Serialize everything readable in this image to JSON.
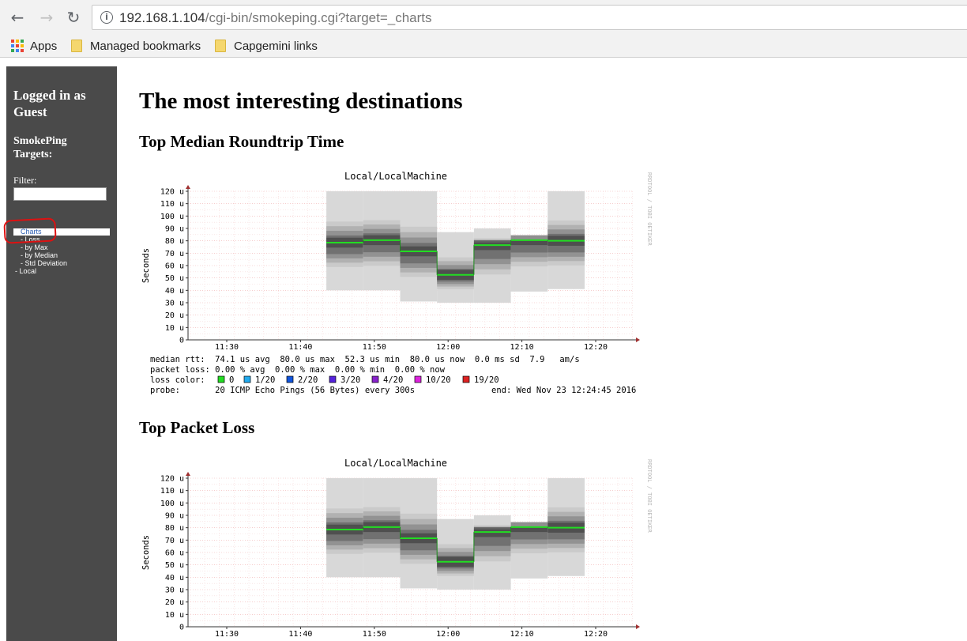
{
  "browser": {
    "back_icon": "arrow-left-icon",
    "forward_icon": "arrow-right-icon",
    "reload_icon": "reload-icon",
    "url_host": "192.168.1.104",
    "url_path": "/cgi-bin/smokeping.cgi?target=_charts",
    "bookmarks": [
      {
        "label": "Apps",
        "icon": "apps-grid-icon"
      },
      {
        "label": "Managed bookmarks",
        "icon": "folder-icon"
      },
      {
        "label": "Capgemini links",
        "icon": "folder-icon"
      }
    ]
  },
  "sidebar": {
    "logged_in": "Logged in as Guest",
    "targets_title": "SmokePing Targets:",
    "filter_label": "Filter:",
    "filter_value": "",
    "menu": [
      {
        "label": "Charts",
        "selected": true
      },
      {
        "label": "- Loss"
      },
      {
        "label": "- by Max"
      },
      {
        "label": "- by Median"
      },
      {
        "label": "- Std Deviation"
      },
      {
        "label": "- Local"
      }
    ]
  },
  "page": {
    "title": "The most interesting destinations",
    "sections": [
      {
        "heading": "Top Median Roundtrip Time"
      },
      {
        "heading": "Top Packet Loss"
      }
    ]
  },
  "chart_data": [
    {
      "type": "area",
      "title": "Local/LocalMachine",
      "ylabel": "Seconds",
      "watermark": "RRDTOOL / TOBI OETIKER",
      "yticks": [
        "0",
        "10 u",
        "20 u",
        "30 u",
        "40 u",
        "50 u",
        "60 u",
        "70 u",
        "80 u",
        "90 u",
        "100 u",
        "110 u",
        "120 u"
      ],
      "ylim": [
        0,
        120
      ],
      "xticks": [
        "11:30",
        "11:40",
        "11:50",
        "12:00",
        "12:10",
        "12:20"
      ],
      "median_series": [
        {
          "x": "11:46",
          "y": 78.5
        },
        {
          "x": "11:51",
          "y": 80.5
        },
        {
          "x": "11:56",
          "y": 71.5
        },
        {
          "x": "12:01",
          "y": 52.5
        },
        {
          "x": "12:06",
          "y": 76.5
        },
        {
          "x": "12:11",
          "y": 80.5
        },
        {
          "x": "12:16",
          "y": 80
        }
      ],
      "smoke_min": [
        40,
        40,
        31,
        30,
        30,
        39,
        41
      ],
      "smoke_max": [
        120,
        120,
        120,
        87,
        90,
        80,
        120
      ],
      "legend": {
        "median_rtt": "median rtt:  74.1 us avg  80.0 us max  52.3 us min  80.0 us now  0.0 ms sd  7.9   am/s",
        "packet_loss": "packet loss: 0.00 % avg  0.00 % max  0.00 % min  0.00 % now",
        "loss_color_label": "loss color:",
        "loss_colors": [
          {
            "label": "0",
            "color": "#22dd22"
          },
          {
            "label": "1/20",
            "color": "#22aaee"
          },
          {
            "label": "2/20",
            "color": "#1155dd"
          },
          {
            "label": "3/20",
            "color": "#5522dd"
          },
          {
            "label": "4/20",
            "color": "#8822cc"
          },
          {
            "label": "10/20",
            "color": "#dd22dd"
          },
          {
            "label": "19/20",
            "color": "#dd2222"
          }
        ],
        "probe": "probe:       20 ICMP Echo Pings (56 Bytes) every 300s",
        "end": "end: Wed Nov 23 12:24:45 2016"
      }
    },
    {
      "type": "area",
      "title": "Local/LocalMachine",
      "ylabel": "Seconds",
      "watermark": "RRDTOOL / TOBI OETIKER",
      "yticks": [
        "0",
        "10 u",
        "20 u",
        "30 u",
        "40 u",
        "50 u",
        "60 u",
        "70 u",
        "80 u",
        "90 u",
        "100 u",
        "110 u",
        "120 u"
      ],
      "ylim": [
        0,
        120
      ],
      "xticks": [
        "11:30",
        "11:40",
        "11:50",
        "12:00",
        "12:10",
        "12:20"
      ],
      "median_series": [
        {
          "x": "11:46",
          "y": 78.5
        },
        {
          "x": "11:51",
          "y": 80.5
        },
        {
          "x": "11:56",
          "y": 71.5
        },
        {
          "x": "12:01",
          "y": 52.5
        },
        {
          "x": "12:06",
          "y": 76.5
        },
        {
          "x": "12:11",
          "y": 80.5
        },
        {
          "x": "12:16",
          "y": 80
        }
      ],
      "smoke_min": [
        40,
        40,
        31,
        30,
        30,
        39,
        41
      ],
      "smoke_max": [
        120,
        120,
        120,
        87,
        90,
        80,
        120
      ]
    }
  ]
}
